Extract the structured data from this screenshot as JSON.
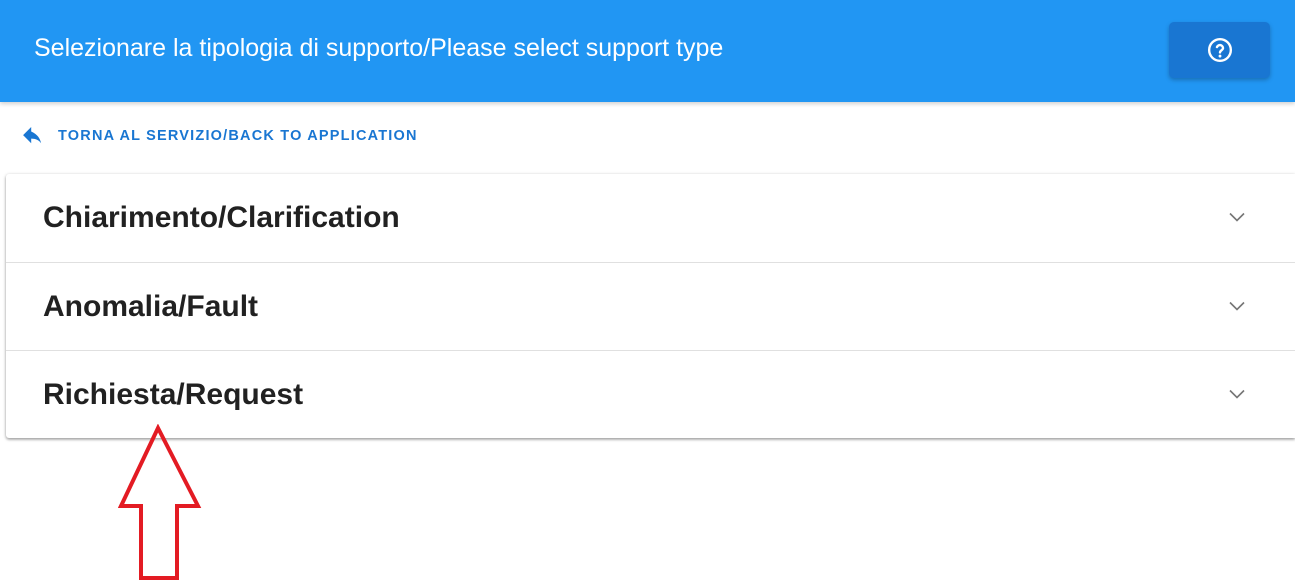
{
  "header": {
    "title": "Selezionare la tipologia di supporto/Please select support type",
    "help_icon": "help-circle-icon",
    "background_color": "#2196f3",
    "button_color": "#1976d2"
  },
  "back_link": {
    "icon": "reply-arrow-icon",
    "label": "TORNA AL SERVIZIO/BACK TO APPLICATION",
    "color": "#1976d2"
  },
  "panels": [
    {
      "label": "Chiarimento/Clarification",
      "icon": "chevron-down-icon"
    },
    {
      "label": "Anomalia/Fault",
      "icon": "chevron-down-icon"
    },
    {
      "label": "Richiesta/Request",
      "icon": "chevron-down-icon"
    }
  ],
  "annotation": {
    "icon": "red-outline-up-arrow-icon",
    "color": "#e31b23"
  }
}
